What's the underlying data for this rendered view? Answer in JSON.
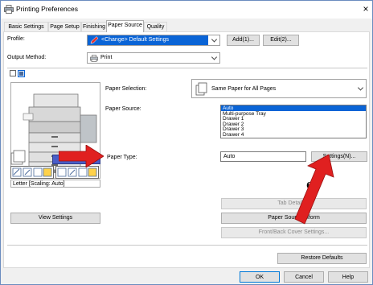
{
  "window": {
    "title": "Printing Preferences",
    "close_glyph": "×"
  },
  "tabs": [
    {
      "label": "Basic Settings"
    },
    {
      "label": "Page Setup"
    },
    {
      "label": "Finishing"
    },
    {
      "label": "Paper Source"
    },
    {
      "label": "Quality"
    }
  ],
  "active_tab": "Paper Source",
  "profile": {
    "label": "Profile:",
    "value": "<Change> Default Settings",
    "add_label": "Add(1)...",
    "edit_label": "Edit(2)..."
  },
  "output_method": {
    "label": "Output Method:",
    "value": "Print"
  },
  "paper_selection": {
    "label": "Paper Selection:",
    "value": "Same Paper for All Pages"
  },
  "paper_source": {
    "label": "Paper Source:",
    "options": [
      "Auto",
      "Multi-purpose Tray",
      "Drawer 1",
      "Drawer 2",
      "Drawer 3",
      "Drawer 4"
    ],
    "selected": "Auto"
  },
  "paper_type": {
    "label": "Paper Type:",
    "value": "Auto",
    "settings_label": "Settings(N)..."
  },
  "preview": {
    "auto_label": "Auto",
    "caption": "Letter [Scaling: Auto]"
  },
  "annotation": {
    "step_label": "6."
  },
  "buttons": {
    "view_settings": "View Settings",
    "tab_details": "Tab Details...",
    "paper_source_info": "Paper Source Inform",
    "front_back_cover": "Front/Back Cover Settings...",
    "restore_defaults": "Restore Defaults",
    "ok": "OK",
    "cancel": "Cancel",
    "help": "Help"
  },
  "colors": {
    "accent_blue": "#0a64d6",
    "arrow_red": "#e02020",
    "profile_icon_red": "#cc2020"
  }
}
